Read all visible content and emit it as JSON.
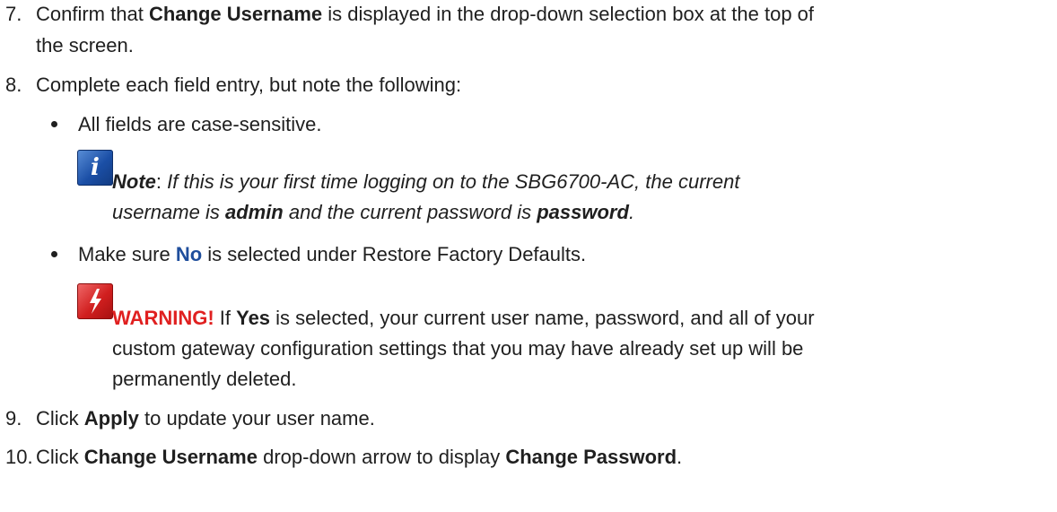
{
  "steps": {
    "s7": {
      "num": "7.",
      "line1_pre": "Confirm that ",
      "line1_bold": "Change Username",
      "line1_post": " is displayed in the drop-down selection box at the top of",
      "line2": "the screen."
    },
    "s8": {
      "num": "8.",
      "text": "Complete each field entry, but note the following:"
    },
    "bullet1": "All fields are case-sensitive.",
    "note": {
      "label": "Note",
      "colon": ": ",
      "line1": "If this is your first time logging on to the SBG6700-AC, the current",
      "line2_pre": "username is ",
      "line2_b1": "admin",
      "line2_mid": " and the current password is ",
      "line2_b2": "password",
      "line2_post": "."
    },
    "bullet2": {
      "pre": "Make sure ",
      "highlight": "No",
      "post": " is selected under Restore Factory Defaults."
    },
    "warning": {
      "label": "WARNING!",
      "mid1": " If ",
      "yes": "Yes",
      "line1_post": " is selected, your current user name, password, and all of your",
      "line2": "custom gateway configuration settings that you may have already set up will be",
      "line3": "permanently deleted."
    },
    "s9": {
      "num": "9.",
      "pre": "Click ",
      "bold": "Apply",
      "post": " to update your user name."
    },
    "s10": {
      "num": "10.",
      "pre": "Click ",
      "bold1": "Change Username",
      "mid": " drop-down arrow to display ",
      "bold2": "Change Password",
      "post": "."
    }
  },
  "icons": {
    "info": "info-icon",
    "warning": "warning-icon"
  },
  "colors": {
    "text": "#1f1f1f",
    "highlight_blue": "#1f4e9c",
    "warning_red": "#e02020"
  }
}
